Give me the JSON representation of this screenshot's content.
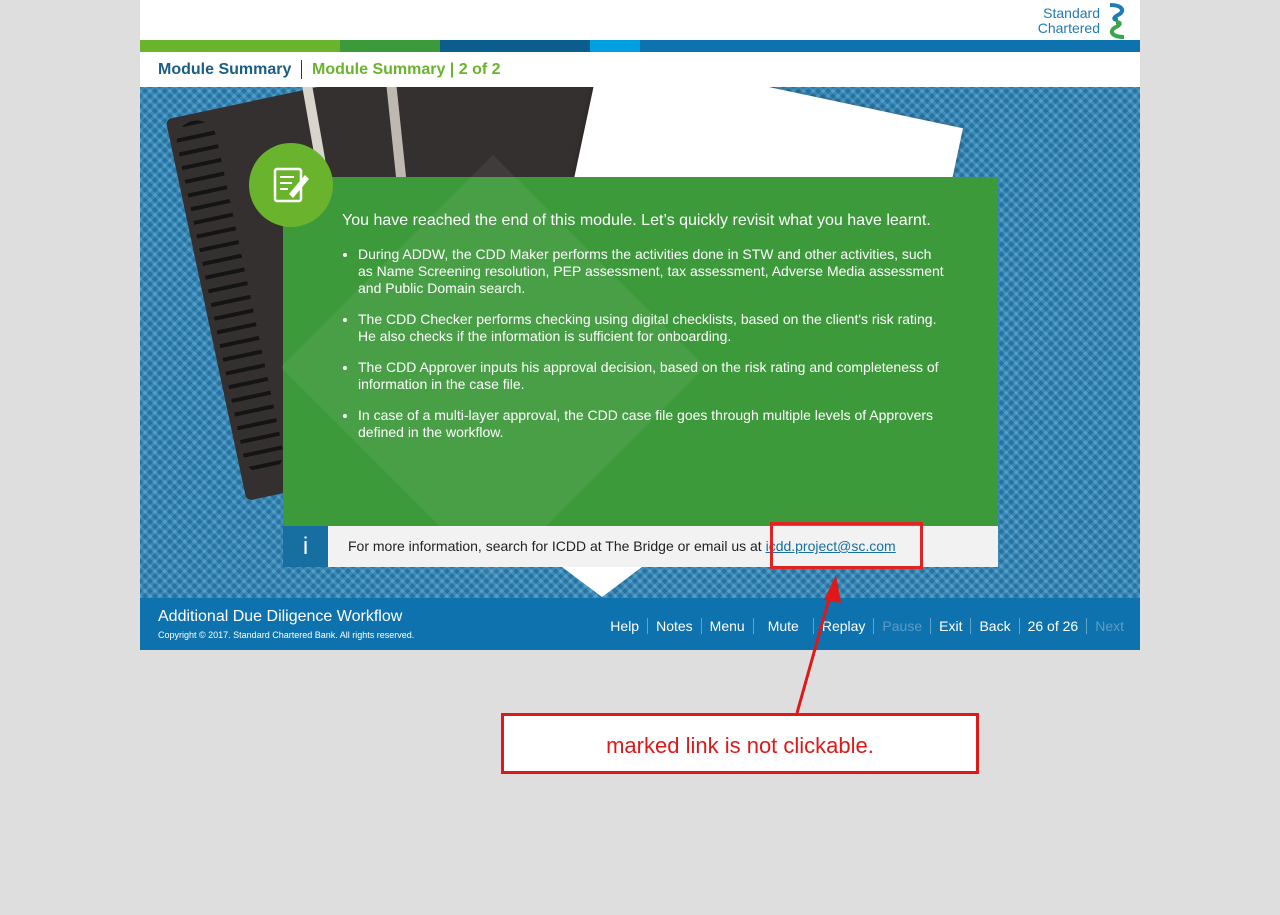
{
  "brand": {
    "logo_line1": "Standard",
    "logo_line2": "Chartered"
  },
  "breadcrumb": {
    "module": "Module Summary",
    "current": "Module Summary | 2 of 2"
  },
  "card": {
    "heading": "You have reached the end of this module. Let’s quickly revisit what you have learnt.",
    "bullets": [
      "During ADDW, the CDD Maker performs the activities done in STW and other activities, such as Name Screening resolution, PEP assessment, tax assessment, Adverse Media assessment and Public Domain search.",
      "The CDD Checker performs checking using digital checklists, based on the client's risk rating. He also checks if the information is sufficient for onboarding.",
      "The CDD Approver inputs his approval decision, based on the risk rating and completeness of information in the case file.",
      "In case of a multi-layer approval, the CDD case file goes through multiple levels of Approvers defined in the workflow."
    ],
    "icon": "notes-edit-icon"
  },
  "info": {
    "icon_letter": "i",
    "text": "For more information, search for ICDD at The Bridge or email us at",
    "link": "icdd.project@sc.com"
  },
  "footer": {
    "title": "Additional Due Diligence Workflow",
    "copyright": "Copyright © 2017. Standard Chartered Bank. All rights reserved.",
    "nav": {
      "help": "Help",
      "notes": "Notes",
      "menu": "Menu",
      "mute": "Mute",
      "replay": "Replay",
      "pause": "Pause",
      "exit": "Exit",
      "back": "Back",
      "page": "26 of 26",
      "next": "Next"
    }
  },
  "annotation": {
    "text": "marked link is not clickable."
  },
  "colors": {
    "stripe": [
      "#6ab42d",
      "#3d9a3b",
      "#0b5d8c",
      "#00a0e0",
      "#0e72ae"
    ],
    "card_green": "#3d9a3b",
    "accent_green": "#6ab42d",
    "footer_blue": "#0e72ae",
    "annotation_red": "#e01818"
  }
}
